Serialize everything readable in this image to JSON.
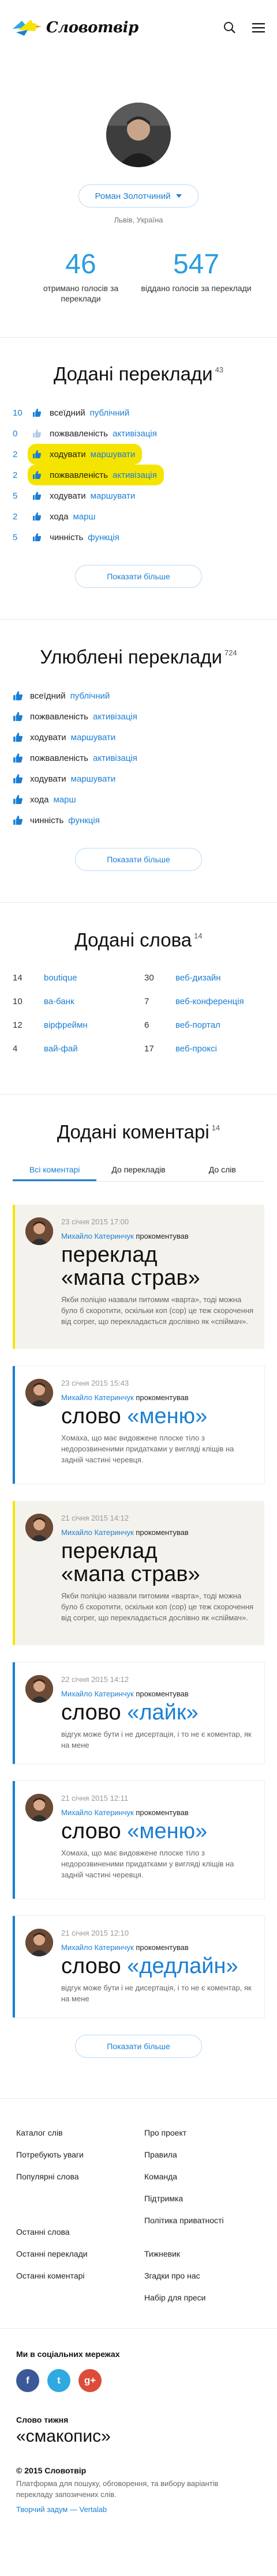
{
  "header": {
    "logo_text": "Словотвір",
    "icons": [
      "search-icon",
      "menu-icon"
    ]
  },
  "profile": {
    "name": "Роман Золотчиний",
    "location": "Львів, Україна",
    "stats": [
      {
        "value": "46",
        "label": "отримано голосів за переклади"
      },
      {
        "value": "547",
        "label": "віддано голосів за переклади"
      }
    ]
  },
  "added_translations": {
    "title": "Додані переклади",
    "count": "43",
    "rows": [
      {
        "count": "10",
        "word": "всеїдний",
        "translation": "публічний"
      },
      {
        "count": "0",
        "word": "пожвавленість",
        "translation": "активізація"
      },
      {
        "count": "2",
        "word": "ходувати",
        "translation": "маршувати"
      },
      {
        "count": "2",
        "word": "пожвавленість",
        "translation": "активізація"
      },
      {
        "count": "5",
        "word": "ходувати",
        "translation": "маршувати"
      },
      {
        "count": "2",
        "word": "хода",
        "translation": "марш"
      },
      {
        "count": "5",
        "word": "чинність",
        "translation": "функція"
      }
    ],
    "more_label": "Показати більше"
  },
  "favorite_translations": {
    "title": "Улюблені переклади",
    "count": "724",
    "rows": [
      {
        "word": "всеїдний",
        "translation": "публічний"
      },
      {
        "word": "пожвавленість",
        "translation": "активізація"
      },
      {
        "word": "ходувати",
        "translation": "маршувати"
      },
      {
        "word": "пожвавленість",
        "translation": "активізація"
      },
      {
        "word": "ходувати",
        "translation": "маршувати"
      },
      {
        "word": "хода",
        "translation": "марш"
      },
      {
        "word": "чинність",
        "translation": "функція"
      }
    ],
    "more_label": "Показати більше"
  },
  "added_words": {
    "title": "Додані слова",
    "count": "14",
    "items": [
      {
        "n": "14",
        "w": "boutique"
      },
      {
        "n": "30",
        "w": "веб-дизайн"
      },
      {
        "n": "10",
        "w": "ва-банк"
      },
      {
        "n": "7",
        "w": "веб-конференція"
      },
      {
        "n": "12",
        "w": "вірфреймн"
      },
      {
        "n": "6",
        "w": "веб-портал"
      },
      {
        "n": "4",
        "w": "вай-фай"
      },
      {
        "n": "17",
        "w": "веб-проксі"
      }
    ]
  },
  "added_comments": {
    "title": "Додані коментарі",
    "count": "14",
    "tabs": [
      "Всі коментарі",
      "До перекладів",
      "До слів"
    ],
    "cards": [
      {
        "date": "23 січня 2015   17:00",
        "author": "Михайло Катеринчук",
        "action": "прокоментував",
        "prefix": "переклад",
        "quote": "«мапа страв»",
        "text": "Якби поліцію назвали питомим «варта», тоді можна було б скоротити, оскільки коп (cop) це теж скорочення від corper, що перекладається дослівно як «спіймач»."
      },
      {
        "date": "23 січня 2015   15:43",
        "author": "Михайло Катеринчук",
        "action": "прокоментував",
        "prefix": "слово",
        "quote": "«меню»",
        "text": "Хомаха, що має видовжене плоске тіло з недорозвиненими придатками у вигляді кліщів на задній частині черевця."
      },
      {
        "date": "21 січня 2015   14:12",
        "author": "Михайло Катеринчук",
        "action": "прокоментував",
        "prefix": "переклад",
        "quote": "«мапа страв»",
        "text": "Якби поліцію назвали питомим «варта», тоді можна було б скоротити, оскільки коп (cop) це теж скорочення від corper, що перекладається дослівно як «спіймач»."
      },
      {
        "date": "22 січня 2015   14:12",
        "author": "Михайло Катеринчук",
        "action": "прокоментував",
        "prefix": "слово",
        "quote": "«лайк»",
        "text": "відгук може бути і не дисертація, і то не є коментар, як на мене"
      },
      {
        "date": "21 січня 2015   12:11",
        "author": "Михайло Катеринчук",
        "action": "прокоментував",
        "prefix": "слово",
        "quote": "«меню»",
        "text": "Хомаха, що має видовжене плоске тіло з недорозвиненими придатками у вигляді кліщів на задній частині черевця."
      },
      {
        "date": "21 січня 2015   12:10",
        "author": "Михайло Катеринчук",
        "action": "прокоментував",
        "prefix": "слово",
        "quote": "«дедлайн»",
        "text": "відгук може бути і не дисертація, і то не є коментар, як на мене"
      }
    ],
    "more_label": "Показати більше"
  },
  "footer": {
    "links_left": [
      "Каталог слів",
      "Потребують уваги",
      "Популярні слова",
      "Останні слова",
      "Останні переклади",
      "Останні коментарі"
    ],
    "links_right": [
      "Про проект",
      "Правила",
      "Команда",
      "Підтримка",
      "Політика приватності",
      "Тижневик",
      "Згадки про нас",
      "Набір для преси"
    ],
    "social_title": "Ми в соціальних мережах",
    "social": [
      {
        "label": "f",
        "color": "#3b5998",
        "icon": "facebook-icon"
      },
      {
        "label": "t",
        "color": "#2fa9e0",
        "icon": "twitter-icon"
      },
      {
        "label": "g+",
        "color": "#dd4b39",
        "icon": "google-plus-icon"
      }
    ],
    "wotd_label": "Слово тижня",
    "wotd": "«смакопис»",
    "copyright": "© 2015 Словотвір",
    "description": "Платформа для пошуку, обговорення, та вибору варіантів перекладу запозичених слів.",
    "credit": "Творчий задум — Vertalab"
  },
  "colors": {
    "accent": "#1a7fd4",
    "highlight": "#f5e400",
    "stat": "#2b9ce0",
    "card_beige": "#f4f2ec"
  }
}
